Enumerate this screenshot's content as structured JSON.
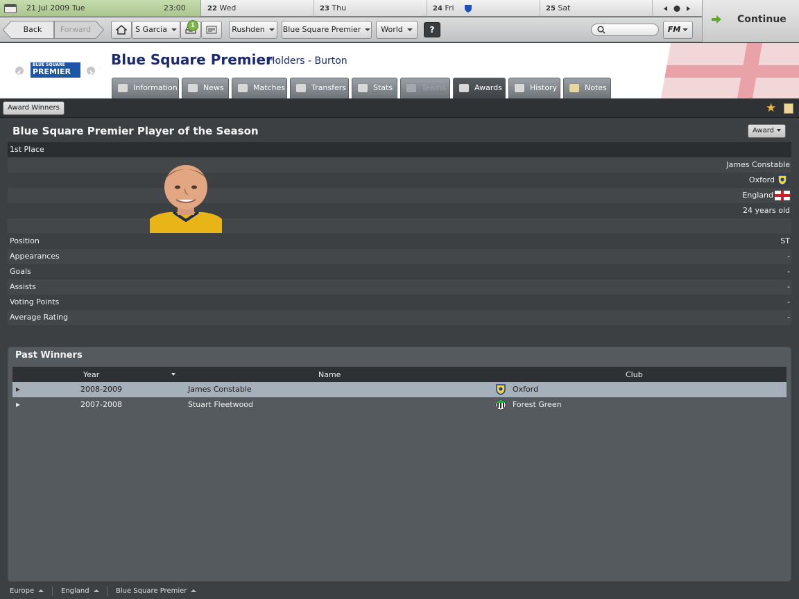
{
  "calendar": {
    "today_date": "21 Jul 2009",
    "today_day": "Tue",
    "today_time": "23:00",
    "days": [
      {
        "num": "22",
        "name": "Wed"
      },
      {
        "num": "23",
        "name": "Thu"
      },
      {
        "num": "24",
        "name": "Fri"
      },
      {
        "num": "25",
        "name": "Sat"
      }
    ]
  },
  "toolbar": {
    "back": "Back",
    "forward": "Forward",
    "manager": "S Garcia",
    "inbox_badge": "1",
    "club": "Rushden",
    "competition": "Blue Square Premier",
    "world": "World",
    "help": "?",
    "fm_menu": "FM",
    "search_placeholder": "",
    "continue": "Continue"
  },
  "header": {
    "title": "Blue Square Premier",
    "holders": "Holders - Burton",
    "logo_line1": "BLUE SQUARE",
    "logo_line2": "PREMIER",
    "tabs": [
      {
        "label": "Information",
        "icon": "list-icon"
      },
      {
        "label": "News",
        "icon": "news-icon"
      },
      {
        "label": "Matches",
        "icon": "shield-icon"
      },
      {
        "label": "Transfers",
        "icon": "transfer-icon"
      },
      {
        "label": "Stats",
        "icon": "stats-icon"
      },
      {
        "label": "Teams",
        "icon": "shield-icon"
      },
      {
        "label": "Awards",
        "icon": "trophy-icon"
      },
      {
        "label": "History",
        "icon": "history-icon"
      },
      {
        "label": "Notes",
        "icon": "notes-icon"
      }
    ]
  },
  "subbar": {
    "section": "Award Winners"
  },
  "award": {
    "title": "Blue Square Premier Player of the Season",
    "dropdown": "Award",
    "place_label": "1st Place",
    "player_name": "James Constable",
    "club": "Oxford",
    "nation": "England",
    "age": "24 years old",
    "stats": [
      {
        "label": "Position",
        "value": "ST"
      },
      {
        "label": "Appearances",
        "value": "-"
      },
      {
        "label": "Goals",
        "value": "-"
      },
      {
        "label": "Assists",
        "value": "-"
      },
      {
        "label": "Voting Points",
        "value": "-"
      },
      {
        "label": "Average Rating",
        "value": "-"
      }
    ]
  },
  "past_winners": {
    "title": "Past Winners",
    "columns": {
      "year": "Year",
      "name": "Name",
      "club": "Club"
    },
    "rows": [
      {
        "year": "2008-2009",
        "name": "James Constable",
        "club": "Oxford"
      },
      {
        "year": "2007-2008",
        "name": "Stuart Fleetwood",
        "club": "Forest Green"
      }
    ]
  },
  "breadcrumbs": [
    "Europe",
    "England",
    "Blue Square Premier"
  ],
  "colors": {
    "title_blue": "#1b2a6e",
    "panel_bg": "#3c4043",
    "selected_row": "#a5b0ba",
    "continue_arrow": "#5fa82c"
  }
}
